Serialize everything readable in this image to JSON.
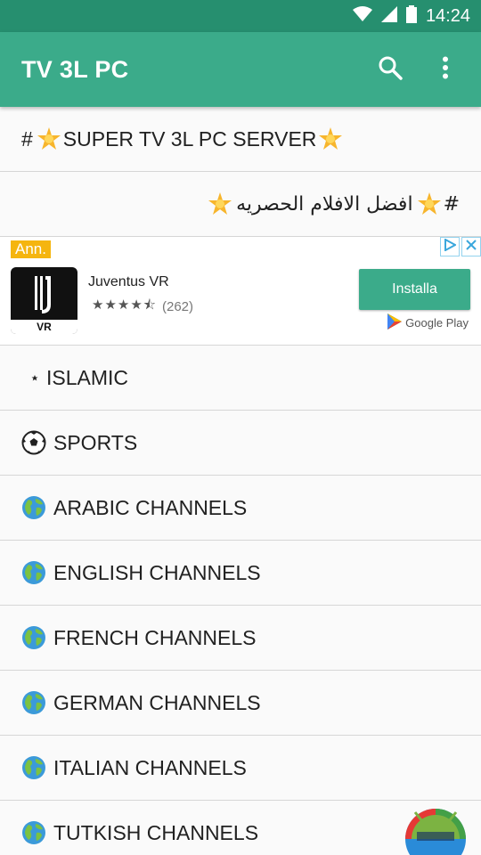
{
  "status_bar": {
    "time": "14:24"
  },
  "app_bar": {
    "title": "TV 3L PC",
    "search_icon": "search-icon",
    "menu_icon": "more-vert-icon"
  },
  "list_top": [
    {
      "hash": "#",
      "label": "SUPER TV 3L PC SERVER",
      "icon": "sparkle-star-icon"
    },
    {
      "hash": "#",
      "label": "افضل الافلام الحصريه",
      "icon": "sparkle-star-icon"
    }
  ],
  "ad": {
    "badge": "Ann.",
    "app_name": "Juventus VR",
    "rating_count": "(262)",
    "rating": 4.5,
    "install_label": "Installa",
    "store_label": "Google Play",
    "icon_caption": "VR"
  },
  "list_categories": [
    {
      "label": "ISLAMIC",
      "icon": "crescent-star-icon"
    },
    {
      "label": "SPORTS",
      "icon": "soccer-ball-icon"
    },
    {
      "label": "ARABIC CHANNELS",
      "icon": "globe-icon"
    },
    {
      "label": "ENGLISH CHANNELS",
      "icon": "globe-icon"
    },
    {
      "label": "FRENCH CHANNELS",
      "icon": "globe-icon"
    },
    {
      "label": "GERMAN CHANNELS",
      "icon": "globe-icon"
    },
    {
      "label": "ITALIAN CHANNELS",
      "icon": "globe-icon"
    },
    {
      "label": "TUTKISH CHANNELS",
      "icon": "globe-icon"
    }
  ],
  "colors": {
    "status_bar": "#268f6f",
    "app_bar": "#3bab8a",
    "ad_badge": "#f5b50f"
  }
}
